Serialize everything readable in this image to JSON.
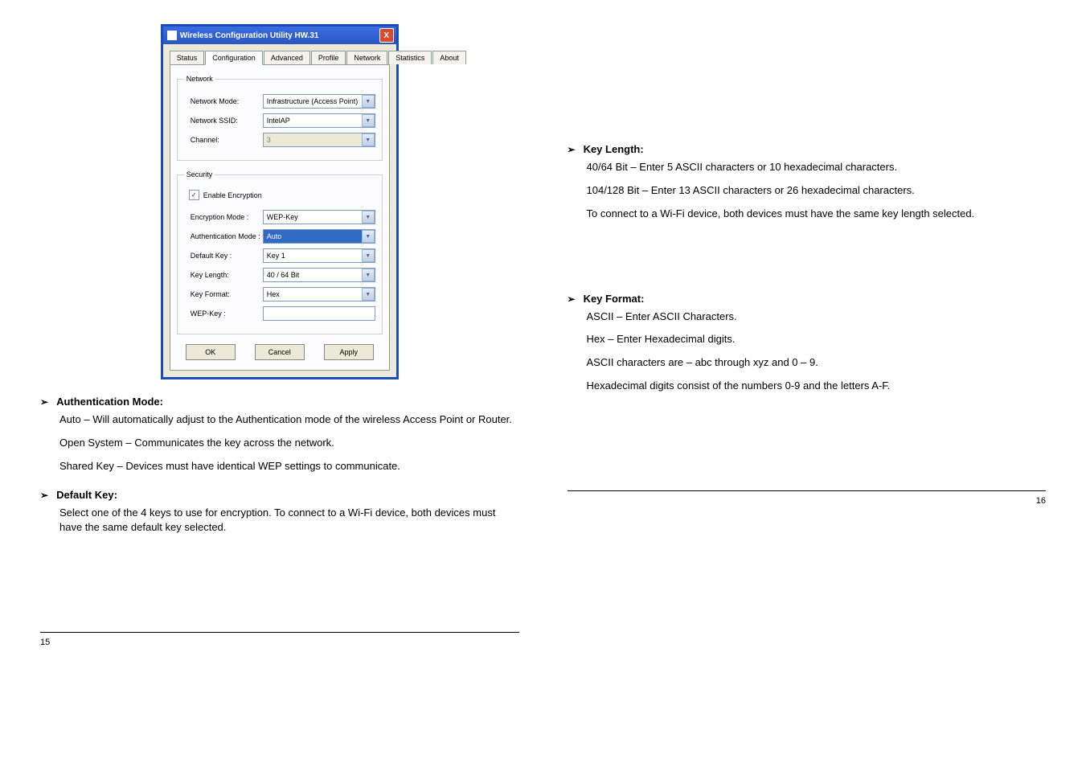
{
  "window": {
    "title": "Wireless Configuration Utility HW.31",
    "close": "X"
  },
  "tabs": {
    "status": "Status",
    "configuration": "Configuration",
    "advanced": "Advanced",
    "profile": "Profile",
    "network": "Network",
    "statistics": "Statistics",
    "about": "About"
  },
  "network_group": {
    "legend": "Network",
    "mode_label": "Network Mode:",
    "mode_value": "Infrastructure (Access Point)",
    "ssid_label": "Network SSID:",
    "ssid_value": "IntelAP",
    "channel_label": "Channel:",
    "channel_value": "3"
  },
  "security_group": {
    "legend": "Security",
    "enable_label": "Enable Encryption",
    "enc_mode_label": "Encryption Mode :",
    "enc_mode_value": "WEP-Key",
    "auth_mode_label": "Authentication Mode :",
    "auth_mode_value": "Auto",
    "default_key_label": "Default Key :",
    "default_key_value": "Key 1",
    "key_length_label": "Key Length:",
    "key_length_value": "40 / 64 Bit",
    "key_format_label": "Key Format:",
    "key_format_value": "Hex",
    "wep_key_label": "WEP-Key :",
    "wep_key_value": ""
  },
  "buttons": {
    "ok": "OK",
    "cancel": "Cancel",
    "apply": "Apply"
  },
  "text": {
    "auth_title": "Authentication Mode:",
    "auth_body1": "Auto – Will automatically adjust to the Authentication mode of the wireless Access Point or Router.",
    "auth_body2": "Open System – Communicates the key across the network.",
    "auth_body3": "Shared Key – Devices must have identical WEP settings to communicate.",
    "default_key_title": "Default Key:",
    "default_key_body": "Select one of the 4 keys to use for encryption. To connect to a Wi-Fi device, both devices must have the same default key selected.",
    "key_len_title": "Key Length:",
    "key_len_body1": "40/64 Bit – Enter 5 ASCII characters or 10 hexadecimal characters.",
    "key_len_body2": "104/128 Bit – Enter 13 ASCII characters or 26 hexadecimal characters.",
    "key_len_body3": "To connect to a Wi-Fi device, both devices must have the same key length selected.",
    "key_fmt_title": "Key Format:",
    "key_fmt_body1": "ASCII – Enter ASCII Characters.",
    "key_fmt_body2": "Hex – Enter Hexadecimal digits.",
    "key_fmt_body3": "ASCII characters are – abc through xyz and 0 – 9.",
    "key_fmt_body4": "Hexadecimal digits consist of the numbers 0-9 and the letters A-F."
  },
  "page_left": "15",
  "page_right": "16"
}
